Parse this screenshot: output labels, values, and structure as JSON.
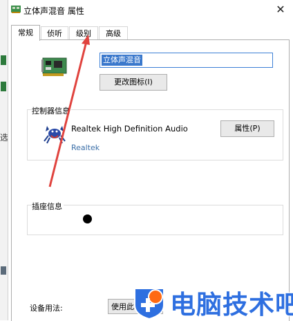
{
  "window": {
    "title": "立体声混音 属性",
    "close_glyph": "✕"
  },
  "tabs": [
    {
      "label": "常规",
      "active": true
    },
    {
      "label": "侦听",
      "active": false
    },
    {
      "label": "级别",
      "active": false
    },
    {
      "label": "高级",
      "active": false
    }
  ],
  "general": {
    "device_name": "立体声混音",
    "change_icon_button": "更改图标(I)"
  },
  "controller": {
    "section_label": "控制器信息",
    "name": "Realtek High Definition Audio",
    "vendor": "Realtek",
    "properties_button": "属性(P)"
  },
  "jack": {
    "section_label": "插座信息"
  },
  "usage": {
    "label": "设备用法:",
    "selected": "使用此设备(启用)"
  },
  "background_window": {
    "partial_text": "选"
  },
  "watermark": {
    "text": "电脑技术吧"
  },
  "colors": {
    "accent": "#3b7fd6",
    "selection": "#3a78cc",
    "watermark": "#2e6fe0",
    "annotation_arrow": "#e0433e"
  }
}
